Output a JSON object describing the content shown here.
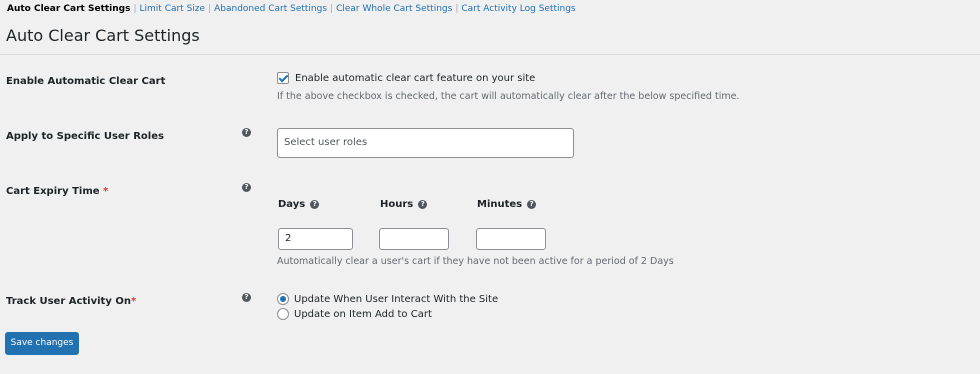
{
  "subnav": {
    "current": "Auto Clear Cart Settings",
    "links": [
      "Limit Cart Size",
      "Abandoned Cart Settings",
      "Clear Whole Cart Settings",
      "Cart Activity Log Settings"
    ],
    "separator": "|"
  },
  "page": {
    "title": "Auto Clear Cart Settings"
  },
  "enable_row": {
    "label": "Enable Automatic Clear Cart",
    "checkbox_label": "Enable automatic clear cart feature on your site",
    "checked": true,
    "description": "If the above checkbox is checked, the cart will automatically clear after the below specified time."
  },
  "roles_row": {
    "label": "Apply to Specific User Roles",
    "placeholder": "Select user roles"
  },
  "expiry_row": {
    "label": "Cart Expiry Time",
    "required_mark": "*",
    "days_label": "Days",
    "hours_label": "Hours",
    "minutes_label": "Minutes",
    "days_value": "2",
    "hours_value": "",
    "minutes_value": "",
    "description": "Automatically clear a user's cart if they have not been active for a period of 2 Days"
  },
  "track_row": {
    "label": "Track User Activity On",
    "required_mark": "*",
    "options": [
      "Update When User Interact With the Site",
      "Update on Item Add to Cart"
    ],
    "selected_index": 0
  },
  "help_icon_glyph": "?",
  "save_button": {
    "label": "Save changes"
  },
  "colors": {
    "accent": "#2271b1",
    "background": "#f0f0f1",
    "required": "#d63638"
  }
}
